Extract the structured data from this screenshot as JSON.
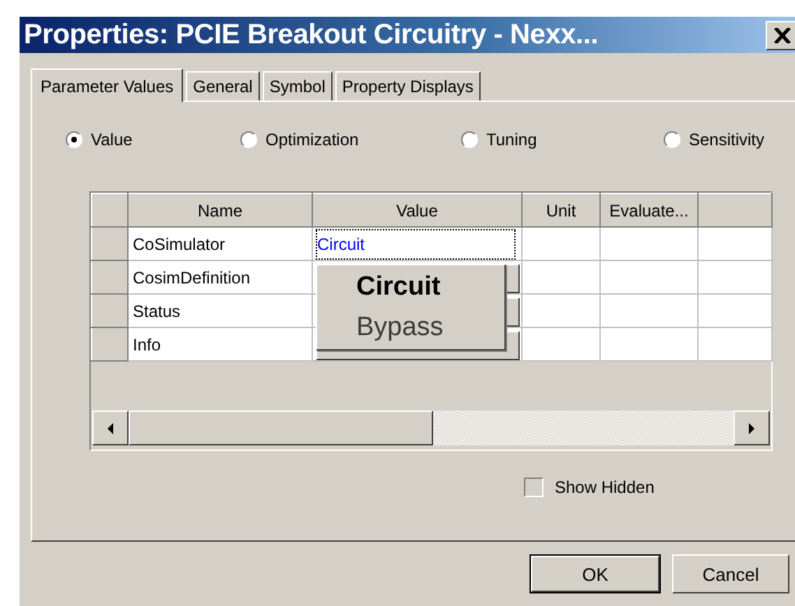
{
  "window": {
    "title": "Properties: PCIE Breakout Circuitry - Nexx..."
  },
  "tabs": [
    {
      "label": "Parameter Values",
      "selected": true
    },
    {
      "label": "General",
      "selected": false
    },
    {
      "label": "Symbol",
      "selected": false
    },
    {
      "label": "Property Displays",
      "selected": false
    }
  ],
  "modes": [
    {
      "label": "Value",
      "selected": true
    },
    {
      "label": "Optimization",
      "selected": false
    },
    {
      "label": "Tuning",
      "selected": false
    },
    {
      "label": "Sensitivity",
      "selected": false
    }
  ],
  "table": {
    "columns": [
      "Name",
      "Value",
      "Unit",
      "Evaluate..."
    ],
    "rows": [
      {
        "name": "CoSimulator",
        "value": {
          "kind": "text",
          "text": "Circuit"
        }
      },
      {
        "name": "CosimDefinition",
        "value": {
          "kind": "button"
        }
      },
      {
        "name": "Status",
        "value": {
          "kind": "button"
        }
      },
      {
        "name": "Info",
        "value": {
          "kind": "button"
        }
      }
    ]
  },
  "dropdown": {
    "options": [
      {
        "label": "Circuit",
        "selected": true
      },
      {
        "label": "Bypass",
        "selected": false
      }
    ]
  },
  "show_hidden": {
    "label": "Show Hidden",
    "checked": false
  },
  "buttons": [
    {
      "label": "OK",
      "default": true
    },
    {
      "label": "Cancel",
      "default": false
    }
  ]
}
